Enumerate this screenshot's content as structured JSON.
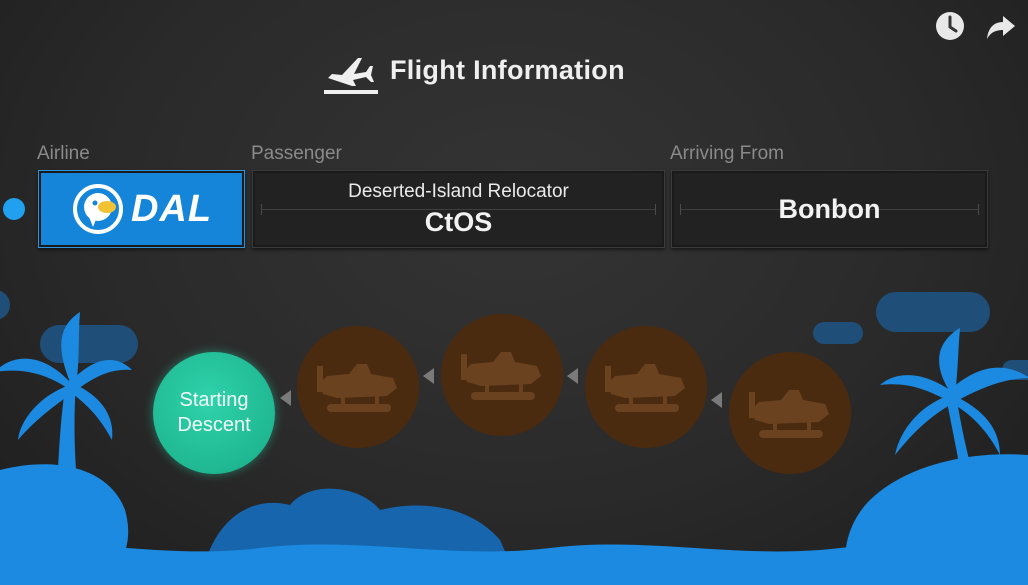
{
  "header": {
    "title": "Flight Information",
    "icon": "plane-departure-icon"
  },
  "top_icons": [
    "clock-icon",
    "share-icon"
  ],
  "fields": {
    "airline": {
      "label": "Airline",
      "logo_text": "DAL"
    },
    "passenger": {
      "label": "Passenger",
      "title": "Deserted-Island Relocator",
      "name": "CtOS"
    },
    "arriving": {
      "label": "Arriving From",
      "value": "Bonbon"
    }
  },
  "progress": {
    "active_label_line1": "Starting",
    "active_label_line2": "Descent",
    "stages_total": 5,
    "stage_index_active": 1
  },
  "colors": {
    "airline_blue": "#1485d8",
    "active_stage": "#1fb892",
    "inactive_stage": "#4a2b10",
    "scenery_blue": "#1b8ae0"
  }
}
